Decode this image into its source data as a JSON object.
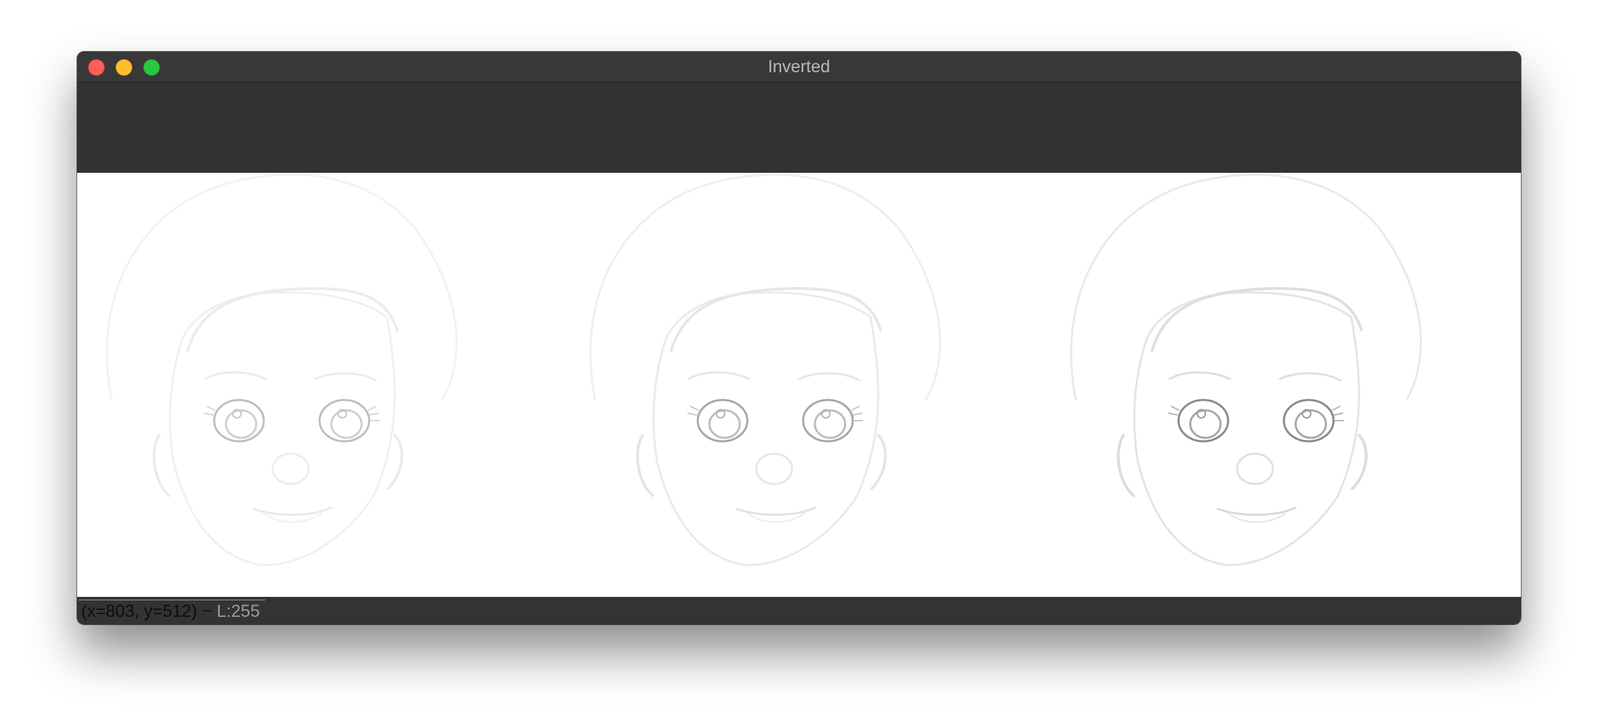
{
  "window": {
    "title": "Inverted",
    "controls": [
      "close-icon",
      "minimize-icon",
      "zoom-icon"
    ]
  },
  "image_panels": [
    {
      "name": "panel-1",
      "description_icon": "face-sketch"
    },
    {
      "name": "panel-2",
      "description_icon": "face-sketch"
    },
    {
      "name": "panel-3",
      "description_icon": "face-sketch"
    }
  ],
  "status": {
    "coordinates": "(x=803, y=512) ~",
    "luminance": "L:255"
  },
  "colors": {
    "titlebar": "#383838",
    "toolbar": "#323232",
    "canvas": "#ffffff",
    "statusbar": "#333333",
    "close": "#fe5f57",
    "minimize": "#febc2e",
    "zoom": "#28c840"
  }
}
